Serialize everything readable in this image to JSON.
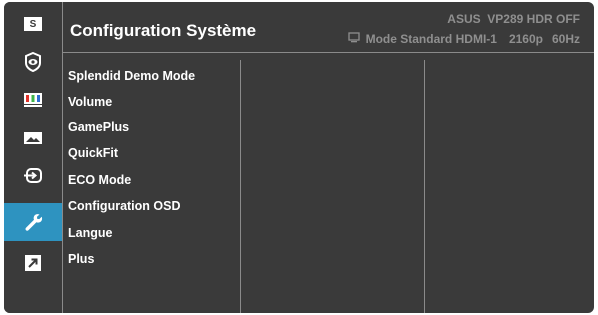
{
  "header": {
    "title": "Configuration Système",
    "model_brand": "ASUS",
    "model_name": "VP289 HDR OFF",
    "mode": "Mode Standard",
    "input": "HDMI-1",
    "resolution": "2160p",
    "refresh": "60Hz"
  },
  "sidebar": {
    "items": [
      {
        "name": "splendid-icon",
        "icon": "S"
      },
      {
        "name": "eye-care-icon"
      },
      {
        "name": "color-icon"
      },
      {
        "name": "image-icon"
      },
      {
        "name": "input-select-icon"
      },
      {
        "name": "wrench-icon",
        "active": true
      },
      {
        "name": "shortcut-icon"
      }
    ]
  },
  "menu": {
    "items": [
      "Splendid Demo Mode",
      "Volume",
      "GamePlus",
      "QuickFit",
      "ECO Mode",
      "Configuration OSD",
      "Langue",
      "Plus"
    ]
  },
  "colors": {
    "background": "#3a3a3a",
    "accent": "#2e93c0",
    "divider": "#8a8a8a",
    "muted_text": "#8f8f8f"
  }
}
